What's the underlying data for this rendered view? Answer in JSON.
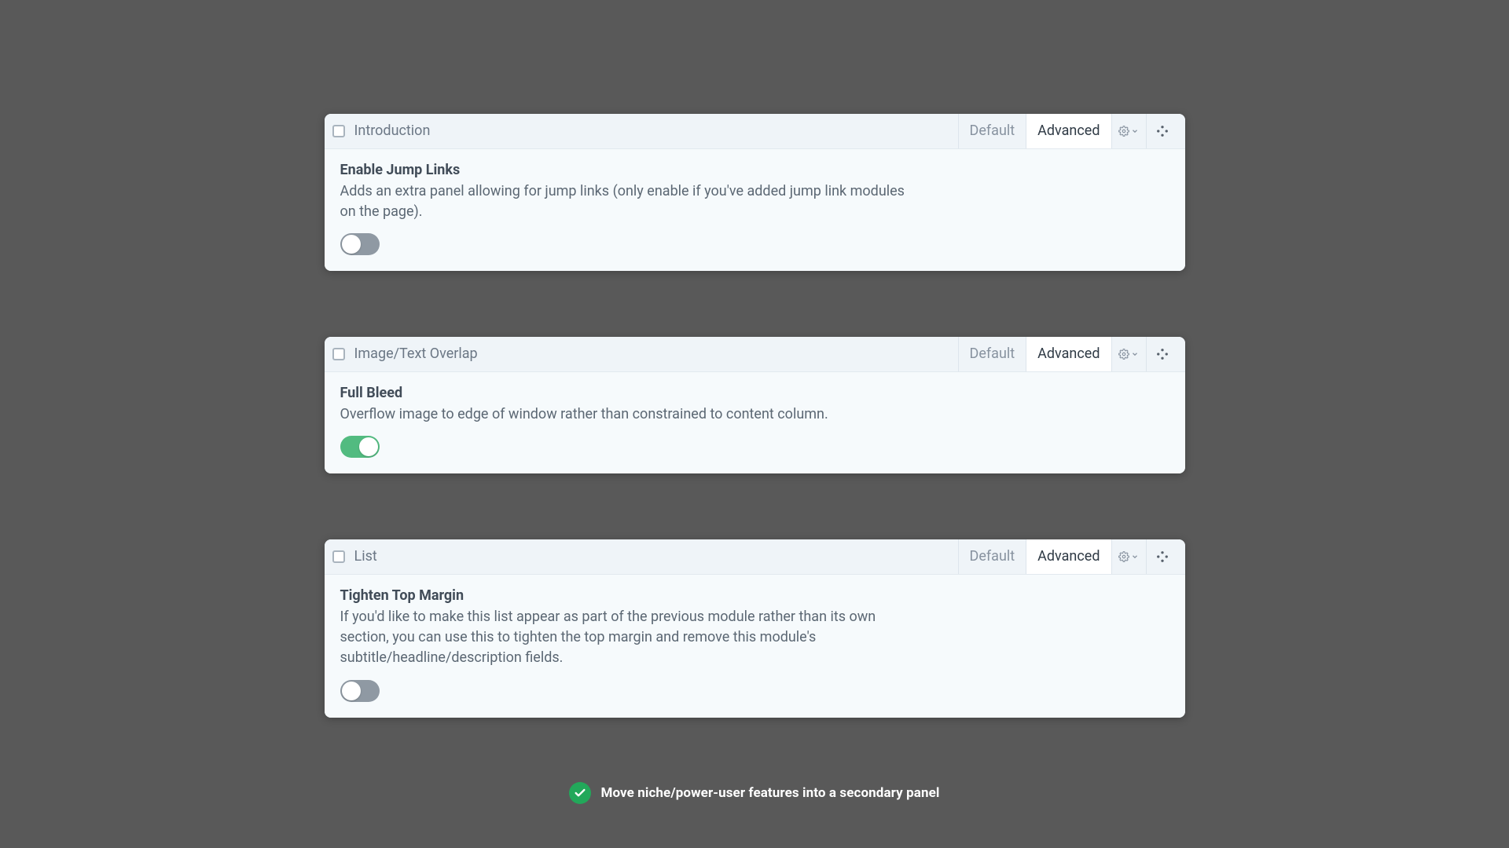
{
  "tabs": {
    "default": "Default",
    "advanced": "Advanced"
  },
  "cards": [
    {
      "name": "Introduction",
      "setting": {
        "title": "Enable Jump Links",
        "desc": "Adds an extra panel allowing for jump links (only enable if you've added jump link modules on the page)."
      },
      "toggle": false
    },
    {
      "name": "Image/Text Overlap",
      "setting": {
        "title": "Full Bleed",
        "desc": "Overflow image to edge of window rather than constrained to content column."
      },
      "toggle": true
    },
    {
      "name": "List",
      "setting": {
        "title": "Tighten Top Margin",
        "desc": "If you'd like to make this list appear as part of the previous module rather than its own section, you can use this to tighten the top margin and remove this module's subtitle/headline/description fields."
      },
      "toggle": false
    }
  ],
  "tip": "Move niche/power-user features into a secondary panel"
}
